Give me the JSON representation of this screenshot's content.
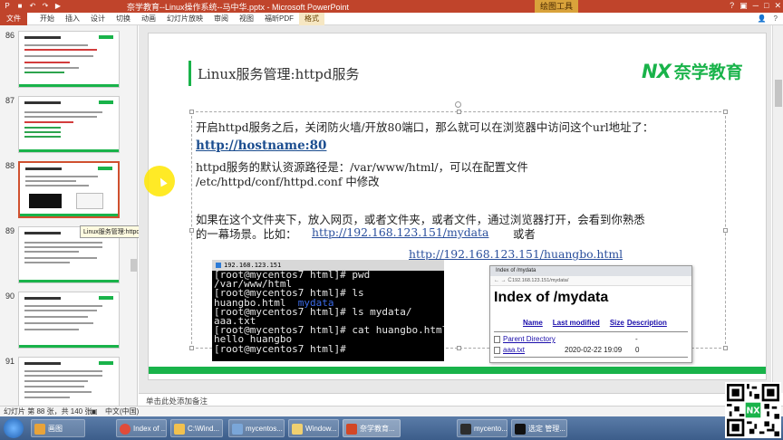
{
  "window": {
    "title": "奈学教育--Linux操作系统--马中华.pptx - Microsoft PowerPoint",
    "tools_label": "绘图工具"
  },
  "ribbon": {
    "file": "文件",
    "tabs": [
      "开始",
      "插入",
      "设计",
      "切换",
      "动画",
      "幻灯片放映",
      "审阅",
      "视图",
      "福昕PDF"
    ],
    "format_tab": "格式"
  },
  "slides_panel": {
    "numbers": [
      "86",
      "87",
      "88",
      "89",
      "90",
      "91"
    ],
    "tooltip": "Linux服务管理:httpd服务"
  },
  "slide": {
    "title": "Linux服务管理:httpd服务",
    "logo_mark": "NX",
    "logo_text": "奈学教育",
    "p1": "开启httpd服务之后，关闭防火墙/开放80端口，那么就可以在浏览器中访问这个url地址了：",
    "url_host": "http://hostname:80",
    "p2_line1": "httpd服务的默认资源路径是：/var/www/html/，可以在配置文件",
    "p2_line2": "/etc/httpd/conf/httpd.conf 中修改",
    "p3_line1": "如果在这个文件夹下，放入网页，或者文件夹，或者文件，通过浏览器打开，会看到你熟悉",
    "p3_line2_prefix": "的一幕场景。比如：",
    "url_mydata": "http://192.168.123.151/mydata",
    "or_word": "或者",
    "url_huangbo": "http://192.168.123.151/huangbo.html"
  },
  "terminal": {
    "tab_label": "192.168.123.151",
    "lines": [
      "[root@mycentos7 html]# pwd",
      "/var/www/html",
      "[root@mycentos7 html]# ls",
      "huangbo.html",
      "[root@mycentos7 html]# ls mydata/",
      "aaa.txt",
      "[root@mycentos7 html]# cat huangbo.html",
      "hello huangbo",
      "[root@mycentos7 html]#"
    ],
    "dir_entry": "mydata"
  },
  "browser": {
    "tab_title": "Index of /mydata",
    "address": "192.168.123.151/mydata/",
    "heading": "Index of /mydata",
    "columns": [
      "Name",
      "Last modified",
      "Size",
      "Description"
    ],
    "rows": [
      {
        "name": "Parent Directory",
        "modified": "",
        "size": "-"
      },
      {
        "name": "aaa.txt",
        "modified": "2020-02-22 19:09",
        "size": "0"
      }
    ]
  },
  "notes": {
    "placeholder": "单击此处添加备注"
  },
  "qr": {
    "center_label": "NX"
  },
  "status": {
    "slide_info": "幻灯片 第 88 张，共 140 张",
    "lang": "中文(中国)"
  },
  "taskbar": {
    "items": [
      "画图",
      "Index of ...",
      "C:\\Wind...",
      "mycentos...",
      "Window...",
      "奈学教育...",
      "mycento...",
      "选定 管理..."
    ]
  },
  "colors": {
    "accent": "#19b34a",
    "office_red": "#c0442b",
    "link_blue": "#2a4f9c"
  }
}
